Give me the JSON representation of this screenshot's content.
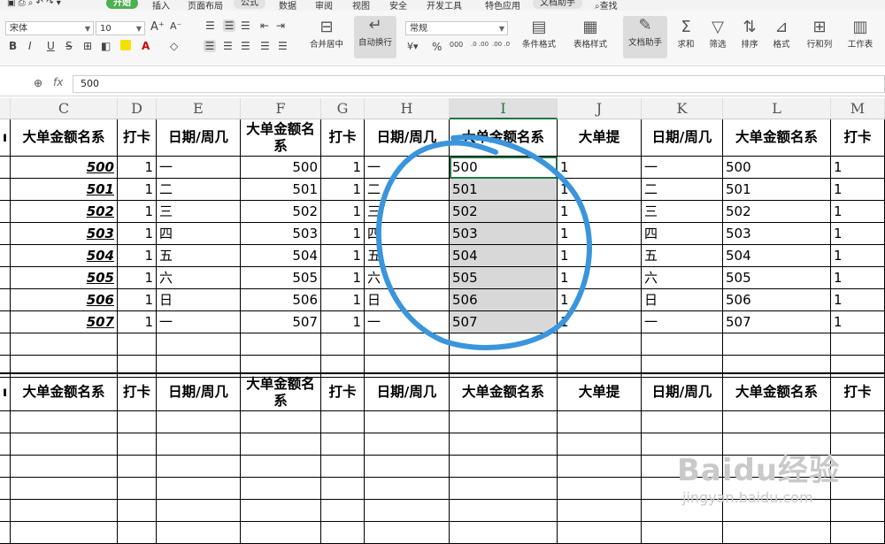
{
  "menu": {
    "tabs": [
      "开始",
      "插入",
      "页面布局",
      "公式",
      "数据",
      "审阅",
      "视图",
      "安全",
      "开发工具",
      "特色应用",
      "文档助手",
      "查找"
    ]
  },
  "toolbar": {
    "font_name": "宋体",
    "font_size": "10",
    "number_format": "常规",
    "bold": "B",
    "italic": "I",
    "underline": "U",
    "merge_center": "合并居中",
    "wrap_text": "自动换行",
    "cond_format": "条件格式",
    "table_style": "表格样式",
    "doc_assistant": "文档助手",
    "sum": "求和",
    "filter": "筛选",
    "sort": "排序",
    "format": "格式",
    "row_col": "行和列",
    "worksheet": "工作表",
    "percent": "%",
    "thousands": "000",
    "dec_inc": ".0 .00",
    "dec_dec": ".00 .0"
  },
  "formula": {
    "fx": "fx",
    "value": "500"
  },
  "columns": [
    {
      "key": "B",
      "label": ""
    },
    {
      "key": "C",
      "label": "C"
    },
    {
      "key": "D",
      "label": "D"
    },
    {
      "key": "E",
      "label": "E"
    },
    {
      "key": "F",
      "label": "F"
    },
    {
      "key": "G",
      "label": "G"
    },
    {
      "key": "H",
      "label": "H"
    },
    {
      "key": "I",
      "label": "I"
    },
    {
      "key": "J",
      "label": "J"
    },
    {
      "key": "K",
      "label": "K"
    },
    {
      "key": "L",
      "label": "L"
    },
    {
      "key": "M",
      "label": "M"
    }
  ],
  "header_row": [
    "ı",
    "大单金额名系",
    "打卡",
    "日期/周几",
    "大单金额名系",
    "打卡",
    "日期/周几",
    "大单金额名系",
    "大单提",
    "日期/周几",
    "大单金额名系",
    "打卡"
  ],
  "rows": [
    [
      "",
      "500",
      "1",
      "一",
      "500",
      "1",
      "一",
      "500",
      "1",
      "一",
      "500",
      "1"
    ],
    [
      "",
      "501",
      "1",
      "二",
      "501",
      "1",
      "二",
      "501",
      "1",
      "二",
      "501",
      "1"
    ],
    [
      "",
      "502",
      "1",
      "三",
      "502",
      "1",
      "三",
      "502",
      "1",
      "三",
      "502",
      "1"
    ],
    [
      "",
      "503",
      "1",
      "四",
      "503",
      "1",
      "四",
      "503",
      "1",
      "四",
      "503",
      "1"
    ],
    [
      "",
      "504",
      "1",
      "五",
      "504",
      "1",
      "五",
      "504",
      "1",
      "五",
      "504",
      "1"
    ],
    [
      "",
      "505",
      "1",
      "六",
      "505",
      "1",
      "六",
      "505",
      "1",
      "六",
      "505",
      "1"
    ],
    [
      "",
      "506",
      "1",
      "日",
      "506",
      "1",
      "日",
      "506",
      "1",
      "日",
      "506",
      "1"
    ],
    [
      "",
      "507",
      "1",
      "一",
      "507",
      "1",
      "一",
      "507",
      "1",
      "一",
      "507",
      "1"
    ]
  ],
  "watermark": {
    "brand": "Baidu经验",
    "url": "jingyan.baidu.com"
  }
}
